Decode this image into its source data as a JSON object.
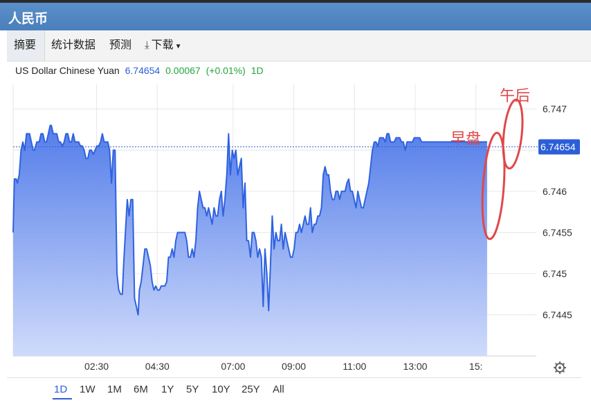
{
  "window": {
    "title": "人民币"
  },
  "tabs": [
    {
      "label": "摘要",
      "active": true
    },
    {
      "label": "统计数据",
      "active": false
    },
    {
      "label": "预测",
      "active": false
    },
    {
      "label": "下载",
      "active": false
    }
  ],
  "quote": {
    "name": "US Dollar Chinese Yuan",
    "price": "6.74654",
    "change": "0.00067",
    "change_pct": "(+0.01%)",
    "period": "1D"
  },
  "ranges": [
    "1D",
    "1W",
    "1M",
    "6M",
    "1Y",
    "5Y",
    "10Y",
    "25Y",
    "All"
  ],
  "active_range": "1D",
  "icons": {
    "download": "download-icon",
    "caret": "caret-down-icon",
    "settings": "gear-icon"
  },
  "colors": {
    "line": "#2f62e0",
    "price_tag": "#2c5fd6",
    "change": "#22a63a",
    "annotation": "#e04848"
  },
  "chart_data": {
    "type": "area",
    "title": "",
    "xlabel": "",
    "ylabel": "",
    "x_ticks": [
      "02:30",
      "04:30",
      "07:00",
      "09:00",
      "11:00",
      "13:00",
      "15:"
    ],
    "y_ticks": [
      "6.747",
      "6.7465",
      "6.746",
      "6.7455",
      "6.745",
      "6.7445"
    ],
    "ylim": [
      6.744,
      6.7473
    ],
    "last_value": "6.74654",
    "grid": true,
    "annotations": [
      {
        "text": "早盘"
      },
      {
        "text": "午后"
      }
    ],
    "x_hours": [
      0.0,
      0.04,
      0.1,
      0.14,
      0.2,
      0.26,
      0.32,
      0.38,
      0.44,
      0.48,
      0.54,
      0.6,
      0.66,
      0.7,
      0.78,
      0.86,
      0.92,
      0.98,
      1.04,
      1.1,
      1.16,
      1.22,
      1.26,
      1.32,
      1.38,
      1.44,
      1.5,
      1.56,
      1.62,
      1.68,
      1.74,
      1.8,
      1.86,
      1.92,
      1.98,
      2.04,
      2.1,
      2.16,
      2.22,
      2.28,
      2.34,
      2.4,
      2.46,
      2.52,
      2.58,
      2.64,
      2.7,
      2.76,
      2.82,
      2.88,
      2.94,
      3.0,
      3.06,
      3.12,
      3.18,
      3.24,
      3.3,
      3.36,
      3.42,
      3.48,
      3.54,
      3.6,
      3.64,
      3.7,
      3.76,
      3.82,
      3.88,
      3.94,
      4.0,
      4.06,
      4.12,
      4.16,
      4.22,
      4.28,
      4.34,
      4.4,
      4.46,
      4.52,
      4.58,
      4.64,
      4.7,
      4.76,
      4.82,
      4.88,
      4.94,
      5.0,
      5.06,
      5.12,
      5.18,
      5.24,
      5.3,
      5.36,
      5.42,
      5.48,
      5.54,
      5.6,
      5.66,
      5.72,
      5.78,
      5.84,
      5.9,
      5.96,
      6.02,
      6.08,
      6.14,
      6.2,
      6.26,
      6.32,
      6.38,
      6.44,
      6.5,
      6.56,
      6.62,
      6.68,
      6.74,
      6.8,
      6.86,
      6.92,
      6.98,
      7.04,
      7.1,
      7.16,
      7.22,
      7.28,
      7.34,
      7.4,
      7.46,
      7.52,
      7.58,
      7.64,
      7.7,
      7.76,
      7.82,
      7.88,
      7.94,
      8.0,
      8.06,
      8.12,
      8.18,
      8.24,
      8.3,
      8.36,
      8.42,
      8.48,
      8.54,
      8.6,
      8.66,
      8.72,
      8.78,
      8.84,
      8.9,
      8.96,
      9.02,
      9.08,
      9.14,
      9.2,
      9.26,
      9.32,
      9.38,
      9.44,
      9.5,
      9.56,
      9.62,
      9.68,
      9.74,
      9.8,
      9.86,
      9.92,
      9.98,
      10.04,
      10.1,
      10.16,
      10.22,
      10.28,
      10.34,
      10.4,
      10.46,
      10.52,
      10.58,
      10.64,
      10.7,
      10.76,
      10.82,
      10.88,
      10.94,
      11.0,
      11.06,
      11.12,
      11.18,
      11.24,
      11.3,
      11.36,
      11.42,
      11.48,
      11.54,
      11.6,
      11.66,
      11.72,
      11.78,
      11.84,
      11.9,
      11.96,
      12.02,
      12.08,
      12.14,
      12.2,
      12.26,
      12.32,
      12.38,
      12.44,
      12.5,
      12.56,
      12.62,
      12.68,
      12.74,
      12.8,
      12.86,
      12.92,
      12.98,
      13.04,
      13.1,
      13.16,
      13.22,
      13.28,
      13.34,
      13.4,
      13.46,
      13.52,
      13.58,
      13.64,
      13.7,
      13.76,
      13.82,
      13.88,
      13.94,
      14.0,
      14.06,
      14.12,
      14.18,
      14.24,
      14.3,
      14.36,
      14.42,
      14.48,
      14.54,
      14.6,
      14.66,
      14.72,
      14.78,
      14.84,
      14.9,
      14.96,
      15.02,
      15.08,
      15.14,
      15.2,
      15.26,
      15.32,
      15.38,
      15.44,
      15.5,
      15.56,
      15.62,
      15.68,
      15.74,
      15.8,
      15.86,
      15.92,
      15.98,
      16.04,
      16.1,
      16.16,
      16.22,
      16.28,
      16.34
    ],
    "values": [
      6.7455,
      6.74615,
      6.74615,
      6.7461,
      6.7462,
      6.7465,
      6.7466,
      6.7465,
      6.7467,
      6.7467,
      6.7467,
      6.7466,
      6.7465,
      6.7465,
      6.7466,
      6.7466,
      6.7467,
      6.7467,
      6.7466,
      6.7466,
      6.7467,
      6.7468,
      6.7468,
      6.7467,
      6.7467,
      6.7467,
      6.7466,
      6.7466,
      6.74655,
      6.7466,
      6.7467,
      6.7467,
      6.7466,
      6.7466,
      6.7467,
      6.7466,
      6.7466,
      6.7466,
      6.74655,
      6.74655,
      6.7465,
      6.7464,
      6.7464,
      6.7465,
      6.7465,
      6.74645,
      6.7465,
      6.74655,
      6.74655,
      6.7466,
      6.7467,
      6.7466,
      6.7466,
      6.7466,
      6.7465,
      6.7461,
      6.7465,
      6.7465,
      6.745,
      6.7448,
      6.74475,
      6.74475,
      6.7451,
      6.7455,
      6.7459,
      6.7457,
      6.7459,
      6.7459,
      6.7447,
      6.7446,
      6.7445,
      6.7448,
      6.7449,
      6.7451,
      6.7453,
      6.7453,
      6.7452,
      6.7451,
      6.7449,
      6.7448,
      6.74485,
      6.7448,
      6.7448,
      6.74485,
      6.74485,
      6.74485,
      6.7449,
      6.7452,
      6.7452,
      6.7453,
      6.7452,
      6.7454,
      6.7455,
      6.7455,
      6.7455,
      6.7455,
      6.7455,
      6.7454,
      6.7452,
      6.7452,
      6.7453,
      6.7452,
      6.7454,
      6.7458,
      6.746,
      6.7459,
      6.7458,
      6.7458,
      6.7457,
      6.7458,
      6.7457,
      6.7456,
      6.7458,
      6.7457,
      6.7457,
      6.7459,
      6.746,
      6.7457,
      6.7459,
      6.7462,
      6.7467,
      6.7462,
      6.7465,
      6.7464,
      6.7465,
      6.7462,
      6.7463,
      6.7464,
      6.7458,
      6.7461,
      6.7454,
      6.7454,
      6.7452,
      6.7455,
      6.7455,
      6.7454,
      6.7452,
      6.7453,
      6.7452,
      6.7446,
      6.7453,
      6.745,
      6.74455,
      6.7451,
      6.7457,
      6.7453,
      6.7455,
      6.7454,
      6.7454,
      6.7456,
      6.7453,
      6.7455,
      6.7454,
      6.7453,
      6.7452,
      6.7452,
      6.7453,
      6.7455,
      6.7455,
      6.7456,
      6.7455,
      6.7456,
      6.7457,
      6.7456,
      6.7456,
      6.7458,
      6.7455,
      6.7456,
      6.7456,
      6.7457,
      6.7457,
      6.7458,
      6.7462,
      6.7463,
      6.7462,
      6.7462,
      6.746,
      6.7459,
      6.7459,
      6.746,
      6.746,
      6.7459,
      6.746,
      6.746,
      6.746,
      6.7461,
      6.74615,
      6.746,
      6.746,
      6.7459,
      6.7458,
      6.746,
      6.7459,
      6.7458,
      6.7458,
      6.7459,
      6.746,
      6.7461,
      6.7463,
      6.7465,
      6.7466,
      6.7466,
      6.74655,
      6.74665,
      6.74665,
      6.74665,
      6.7466,
      6.7467,
      6.7467,
      6.7466,
      6.7466,
      6.7466,
      6.74665,
      6.74665,
      6.74665,
      6.7466,
      6.7466,
      6.7465,
      6.7466,
      6.7466,
      6.7466,
      6.7466,
      6.74665,
      6.74665,
      6.74665,
      6.74665,
      6.7466,
      6.7466,
      6.7466,
      6.7466,
      6.7466,
      6.7466,
      6.7466,
      6.7466,
      6.7466,
      6.7466,
      6.7466,
      6.7466,
      6.7466,
      6.7466,
      6.7466,
      6.7466,
      6.7466,
      6.7466,
      6.7466,
      6.7466,
      6.7466,
      6.7466,
      6.7466,
      6.7466,
      6.7466,
      6.7466,
      6.7466,
      6.7466,
      6.7466,
      6.7466,
      6.7466,
      6.7466,
      6.7466,
      6.7466,
      6.7466,
      6.7466,
      6.7466,
      6.7466,
      6.7466,
      6.7466,
      6.7466,
      6.7466
    ]
  }
}
